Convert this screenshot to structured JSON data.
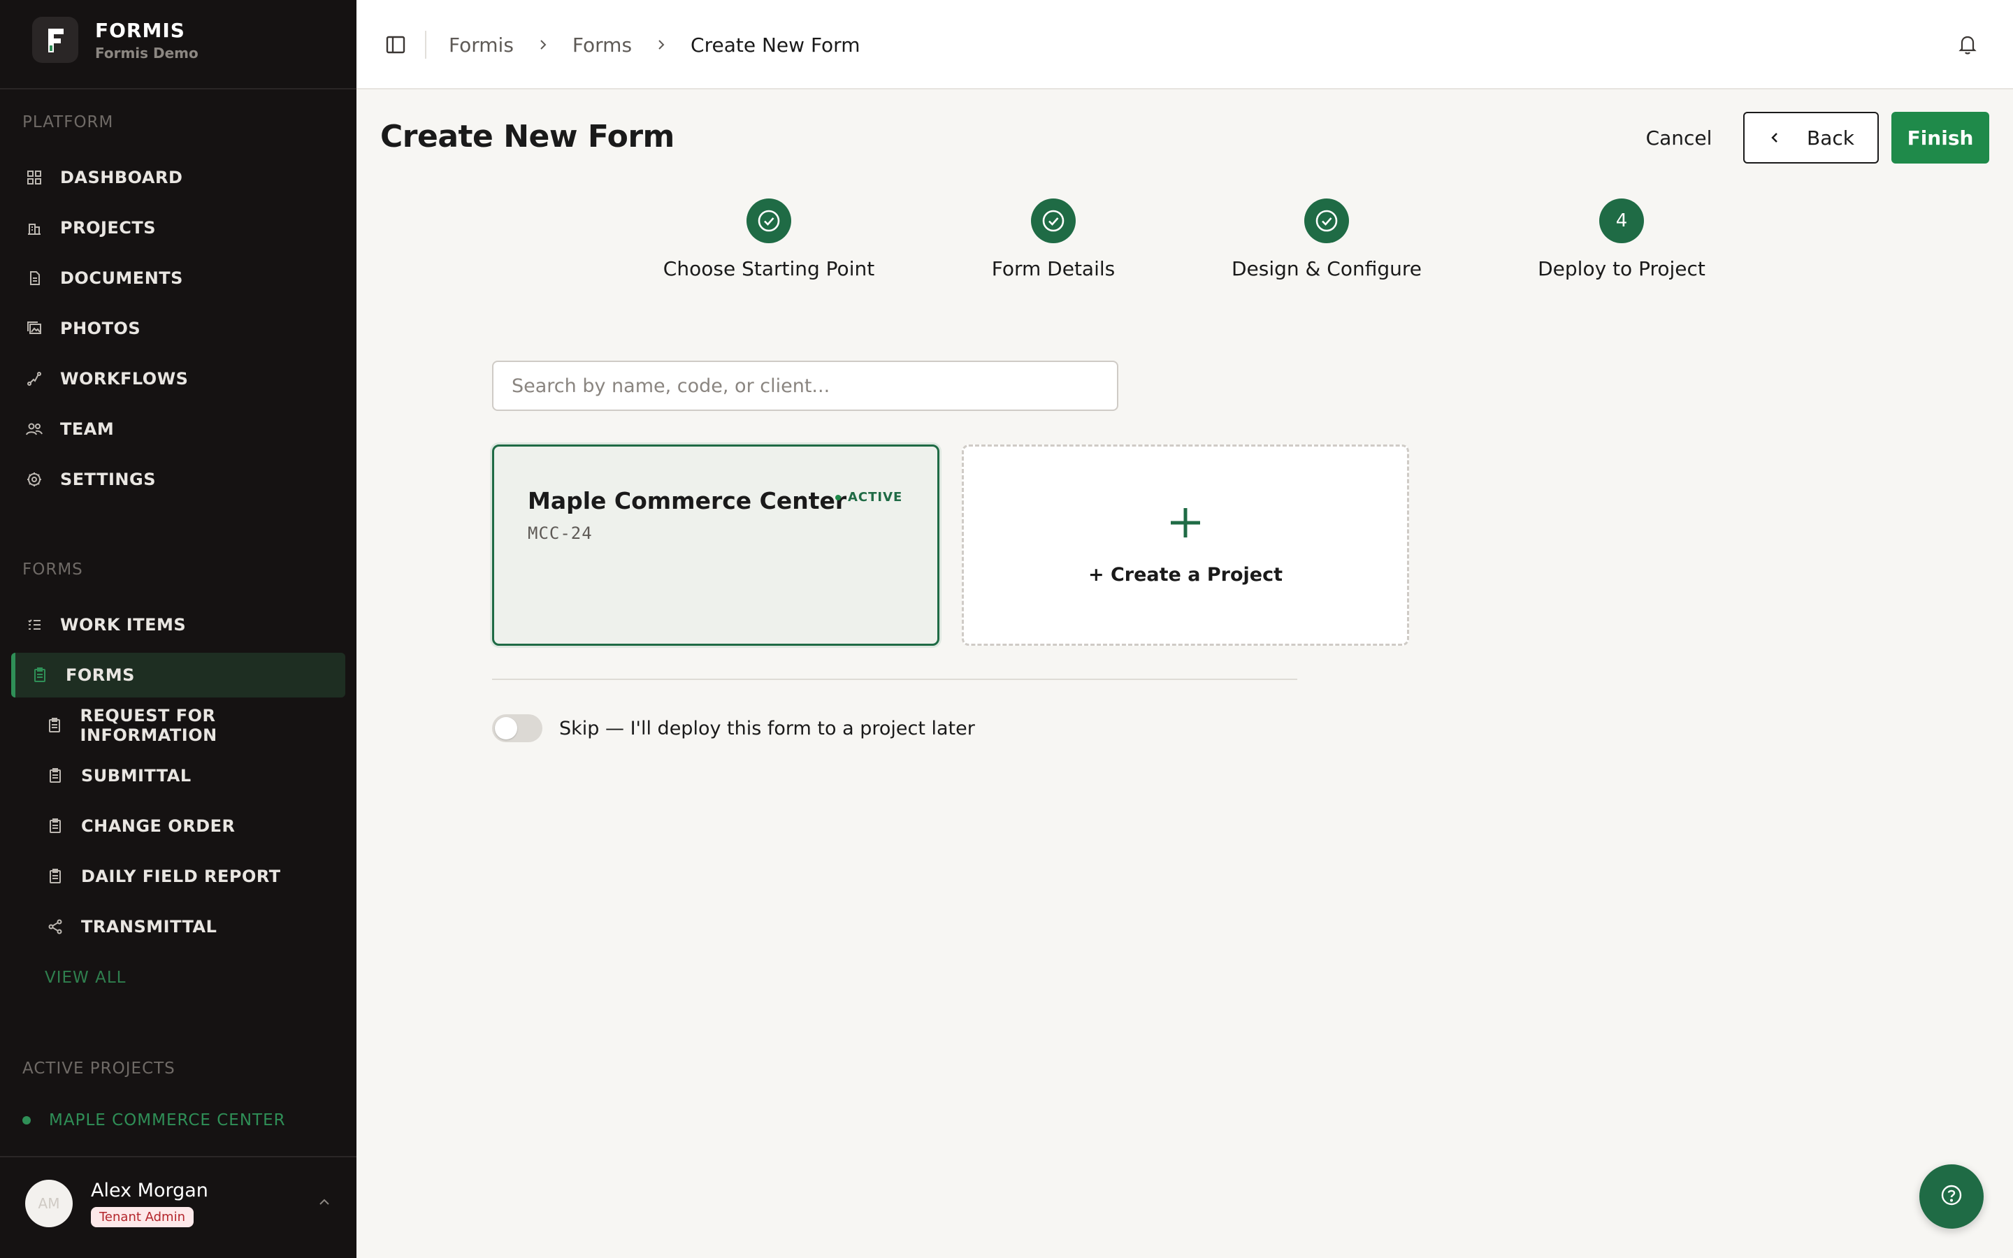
{
  "brand": {
    "name": "FORMIS",
    "subtitle": "Formis Demo"
  },
  "sidebar": {
    "platform_label": "PLATFORM",
    "platform_items": [
      {
        "label": "DASHBOARD",
        "icon": "grid-icon"
      },
      {
        "label": "PROJECTS",
        "icon": "building-icon"
      },
      {
        "label": "DOCUMENTS",
        "icon": "document-icon"
      },
      {
        "label": "PHOTOS",
        "icon": "photos-icon"
      },
      {
        "label": "WORKFLOWS",
        "icon": "workflow-icon"
      },
      {
        "label": "TEAM",
        "icon": "team-icon"
      },
      {
        "label": "SETTINGS",
        "icon": "gear-icon"
      }
    ],
    "forms_label": "FORMS",
    "forms_items": [
      {
        "label": "WORK ITEMS",
        "icon": "list-icon"
      },
      {
        "label": "FORMS",
        "icon": "clipboard-icon",
        "active": true
      }
    ],
    "form_types": [
      {
        "label": "REQUEST FOR INFORMATION",
        "icon": "clipboard-icon"
      },
      {
        "label": "SUBMITTAL",
        "icon": "clipboard-icon"
      },
      {
        "label": "CHANGE ORDER",
        "icon": "clipboard-icon"
      },
      {
        "label": "DAILY FIELD REPORT",
        "icon": "clipboard-icon"
      },
      {
        "label": "TRANSMITTAL",
        "icon": "share-icon"
      }
    ],
    "view_all": "VIEW ALL",
    "active_projects_label": "ACTIVE PROJECTS",
    "active_projects": [
      {
        "label": "MAPLE COMMERCE CENTER"
      }
    ],
    "user": {
      "initials": "AM",
      "name": "Alex Morgan",
      "role": "Tenant Admin"
    }
  },
  "topbar": {
    "breadcrumbs": [
      "Formis",
      "Forms",
      "Create New Form"
    ]
  },
  "page": {
    "title": "Create New Form",
    "cancel_label": "Cancel",
    "back_label": "Back",
    "finish_label": "Finish"
  },
  "steps": [
    {
      "label": "Choose Starting Point",
      "status": "complete"
    },
    {
      "label": "Form Details",
      "status": "complete"
    },
    {
      "label": "Design & Configure",
      "status": "complete"
    },
    {
      "label": "Deploy to Project",
      "status": "current",
      "number": "4"
    }
  ],
  "search": {
    "placeholder": "Search by name, code, or client...",
    "value": ""
  },
  "projects": [
    {
      "name": "Maple Commerce Center",
      "code": "MCC-24",
      "status": "ACTIVE",
      "selected": true
    }
  ],
  "create_project_label": "+ Create a Project",
  "skip": {
    "label": "Skip — I'll deploy this form to a project later",
    "enabled": false
  },
  "colors": {
    "accent": "#1f6b45",
    "primary_button": "#1f8a4a",
    "sidebar_bg": "#151212",
    "page_bg": "#f7f6f3"
  }
}
